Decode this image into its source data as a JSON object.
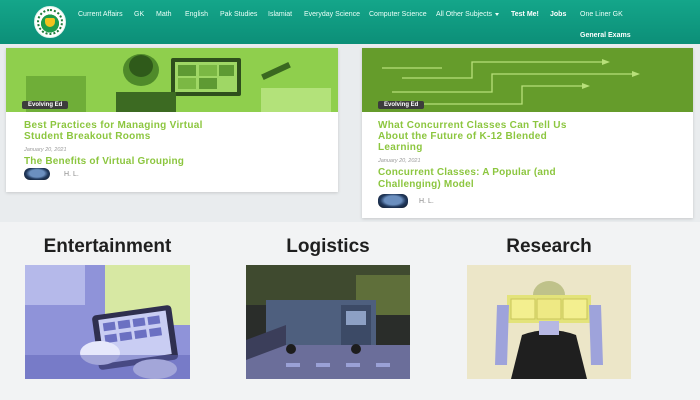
{
  "nav": {
    "items": [
      {
        "label": "Current Affairs"
      },
      {
        "label": "GK"
      },
      {
        "label": "Math"
      },
      {
        "label": "English"
      },
      {
        "label": "Pak Studies"
      },
      {
        "label": "Islamiat"
      },
      {
        "label": "Everyday Science"
      },
      {
        "label": "Computer Science"
      },
      {
        "label": "All Other Subjects"
      },
      {
        "label": "Test Me!"
      },
      {
        "label": "Jobs"
      },
      {
        "label": "One Liner GK"
      },
      {
        "label": "General Exams"
      }
    ]
  },
  "cards": [
    {
      "tag": "Evolving Ed",
      "title_line1": "Best Practices for Managing Virtual",
      "title_line2": "Student Breakout Rooms",
      "date": "January 20, 2021",
      "sub_line1": "The Benefits of Virtual Grouping",
      "author": "H. L."
    },
    {
      "tag": "Evolving Ed",
      "title_line1": "What Concurrent Classes Can Tell Us",
      "title_line2": "About the Future of K-12 Blended",
      "title_line3": "Learning",
      "date": "January 20, 2021",
      "sub_line1": "Concurrent Classes: A Popular (and",
      "sub_line2": "Challenging) Model",
      "author": "H. L."
    }
  ],
  "categories": [
    {
      "title": "Entertainment"
    },
    {
      "title": "Logistics"
    },
    {
      "title": "Research"
    }
  ],
  "colors": {
    "nav_bg": "#0c8f78",
    "accent_green": "#8cc63f",
    "tag_bg": "#3c3c3c"
  }
}
